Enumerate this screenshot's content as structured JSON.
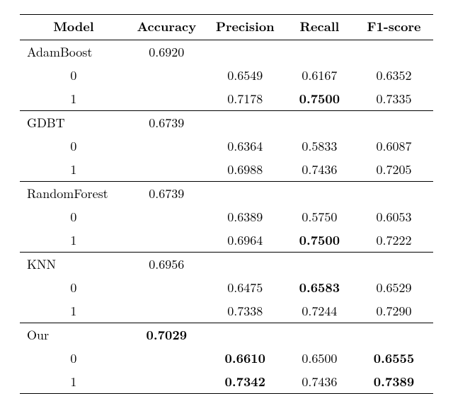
{
  "headers": {
    "model": "Model",
    "accuracy": "Accuracy",
    "precision": "Precision",
    "recall": "Recall",
    "f1": "F1-score"
  },
  "chart_data": {
    "type": "table",
    "title": "",
    "columns": [
      "Model",
      "Accuracy",
      "Precision",
      "Recall",
      "F1-score"
    ],
    "groups": [
      {
        "name": "AdamBoost",
        "accuracy": "0.6920",
        "accuracy_bold": false,
        "rows": [
          {
            "cls": "0",
            "precision": "0.6549",
            "precision_bold": false,
            "recall": "0.6167",
            "recall_bold": false,
            "f1": "0.6352",
            "f1_bold": false
          },
          {
            "cls": "1",
            "precision": "0.7178",
            "precision_bold": false,
            "recall": "0.7500",
            "recall_bold": true,
            "f1": "0.7335",
            "f1_bold": false
          }
        ]
      },
      {
        "name": "GDBT",
        "accuracy": "0.6739",
        "accuracy_bold": false,
        "rows": [
          {
            "cls": "0",
            "precision": "0.6364",
            "precision_bold": false,
            "recall": "0.5833",
            "recall_bold": false,
            "f1": "0.6087",
            "f1_bold": false
          },
          {
            "cls": "1",
            "precision": "0.6988",
            "precision_bold": false,
            "recall": "0.7436",
            "recall_bold": false,
            "f1": "0.7205",
            "f1_bold": false
          }
        ]
      },
      {
        "name": "RandomForest",
        "accuracy": "0.6739",
        "accuracy_bold": false,
        "rows": [
          {
            "cls": "0",
            "precision": "0.6389",
            "precision_bold": false,
            "recall": "0.5750",
            "recall_bold": false,
            "f1": "0.6053",
            "f1_bold": false
          },
          {
            "cls": "1",
            "precision": "0.6964",
            "precision_bold": false,
            "recall": "0.7500",
            "recall_bold": true,
            "f1": "0.7222",
            "f1_bold": false
          }
        ]
      },
      {
        "name": "KNN",
        "accuracy": "0.6956",
        "accuracy_bold": false,
        "rows": [
          {
            "cls": "0",
            "precision": "0.6475",
            "precision_bold": false,
            "recall": "0.6583",
            "recall_bold": true,
            "f1": "0.6529",
            "f1_bold": false
          },
          {
            "cls": "1",
            "precision": "0.7338",
            "precision_bold": false,
            "recall": "0.7244",
            "recall_bold": false,
            "f1": "0.7290",
            "f1_bold": false
          }
        ]
      },
      {
        "name": "Our",
        "accuracy": "0.7029",
        "accuracy_bold": true,
        "rows": [
          {
            "cls": "0",
            "precision": "0.6610",
            "precision_bold": true,
            "recall": "0.6500",
            "recall_bold": false,
            "f1": "0.6555",
            "f1_bold": true
          },
          {
            "cls": "1",
            "precision": "0.7342",
            "precision_bold": true,
            "recall": "0.7436",
            "recall_bold": false,
            "f1": "0.7389",
            "f1_bold": true
          }
        ]
      }
    ]
  }
}
